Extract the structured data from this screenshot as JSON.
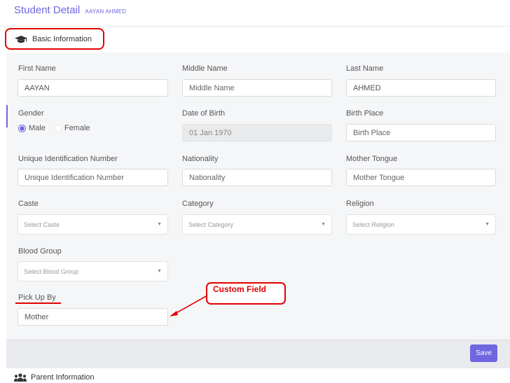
{
  "page": {
    "title": "Student Detail",
    "subtitle": "AAYAN AHMED"
  },
  "tabs": {
    "basic_information": "Basic Information",
    "parent_information": "Parent Information"
  },
  "form": {
    "first_name": {
      "label": "First Name",
      "value": "AAYAN"
    },
    "middle_name": {
      "label": "Middle Name",
      "placeholder": "Middle Name"
    },
    "last_name": {
      "label": "Last Name",
      "value": "AHMED"
    },
    "gender": {
      "label": "Gender",
      "options": [
        "Male",
        "Female"
      ],
      "selected": "Male"
    },
    "date_of_birth": {
      "label": "Date of Birth",
      "value": "01 Jan 1970"
    },
    "birth_place": {
      "label": "Birth Place",
      "placeholder": "Birth Place"
    },
    "unique_id": {
      "label": "Unique Identification Number",
      "placeholder": "Unique Identification Number"
    },
    "nationality": {
      "label": "Nationality",
      "placeholder": "Nationality"
    },
    "mother_tongue": {
      "label": "Mother Tongue",
      "placeholder": "Mother Tongue"
    },
    "caste": {
      "label": "Caste",
      "placeholder": "Select Caste"
    },
    "category": {
      "label": "Category",
      "placeholder": "Select Category"
    },
    "religion": {
      "label": "Religion",
      "placeholder": "Select Religion"
    },
    "blood_group": {
      "label": "Blood Group",
      "placeholder": "Select Blood Group"
    },
    "pick_up_by": {
      "label": "Pick Up By",
      "value": "Mother"
    }
  },
  "annotation": {
    "callout_text": "Custom Field",
    "color": "#e30000"
  },
  "actions": {
    "save_label": "Save"
  },
  "icons": {
    "basic_tab": "graduation-cap-icon",
    "parent_tab": "users-icon",
    "select_caret": "caret-down-icon"
  },
  "colors": {
    "accent": "#6f66e0",
    "annotation": "#e30000",
    "body_bg": "#f5f6f8"
  }
}
